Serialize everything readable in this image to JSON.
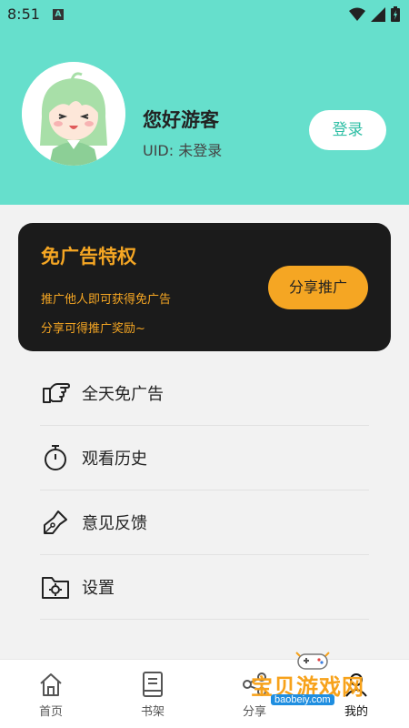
{
  "status_bar": {
    "time": "8:51",
    "app_badge": "A"
  },
  "header": {
    "greeting": "您好游客",
    "uid_text": "UID: 未登录",
    "login_label": "登录",
    "accent_color": "#66dfcc"
  },
  "promo": {
    "title": "免广告特权",
    "line1": "推广他人即可获得免广告",
    "line2": "分享可得推广奖励~",
    "share_label": "分享推广",
    "accent_color": "#f5a623"
  },
  "menu": {
    "items": [
      {
        "label": "全天免广告",
        "icon": "hand-point-icon"
      },
      {
        "label": "观看历史",
        "icon": "stopwatch-icon"
      },
      {
        "label": "意见反馈",
        "icon": "pen-nib-icon"
      },
      {
        "label": "设置",
        "icon": "settings-folder-icon"
      }
    ]
  },
  "tabs": [
    {
      "label": "首页",
      "icon": "home-icon"
    },
    {
      "label": "书架",
      "icon": "book-icon"
    },
    {
      "label": "分享",
      "icon": "share-icon"
    },
    {
      "label": "我的",
      "icon": "user-icon"
    }
  ],
  "watermark": {
    "text": "宝贝游戏网",
    "url": "baobeiy.com"
  }
}
